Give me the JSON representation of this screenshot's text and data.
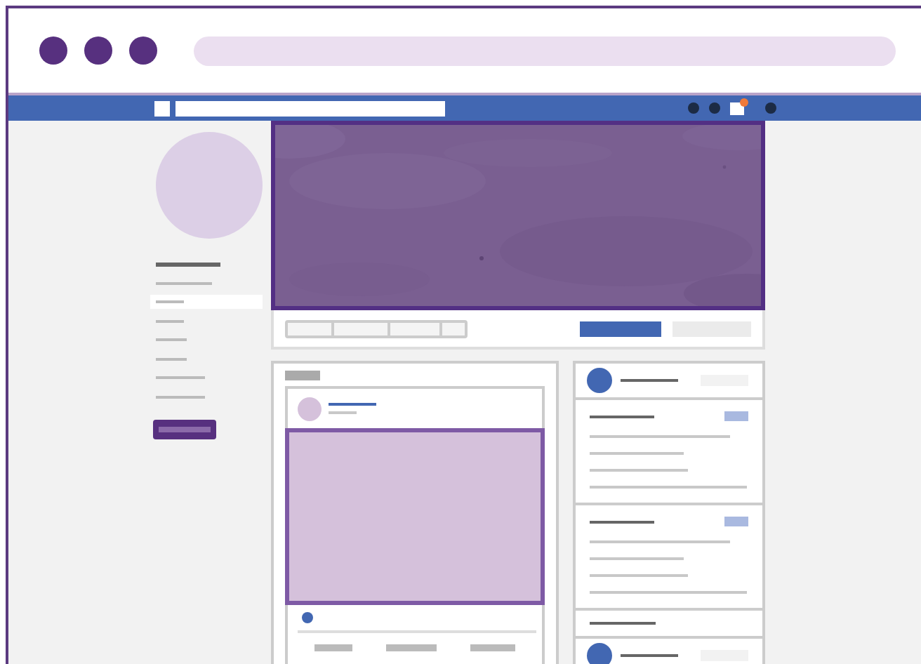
{
  "browser": {
    "notification": {
      "on": true
    }
  },
  "profile": {
    "sidebar": {
      "items": [
        {
          "selected": false
        },
        {
          "selected": false
        },
        {
          "selected": true
        },
        {
          "selected": false
        },
        {
          "selected": false
        },
        {
          "selected": false
        },
        {
          "selected": false
        },
        {
          "selected": false
        }
      ]
    }
  },
  "widgets": [
    {
      "kind": "header"
    },
    {
      "kind": "list"
    },
    {
      "kind": "list"
    },
    {
      "kind": "title"
    },
    {
      "kind": "header"
    }
  ]
}
